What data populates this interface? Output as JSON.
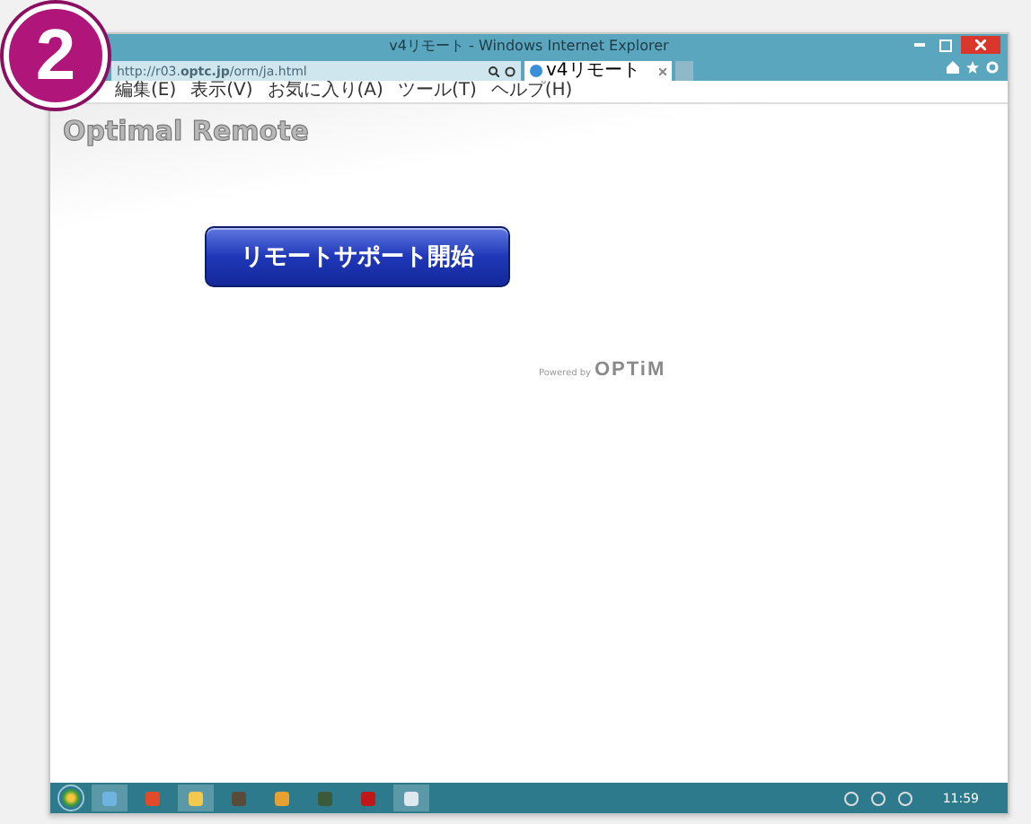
{
  "badge": "2",
  "window": {
    "title": "v4リモート - Windows Internet Explorer"
  },
  "address_bar": {
    "value": "http://r03.**optc.jp**/orm/ja.html"
  },
  "tabs": [
    {
      "label": "v4リモート",
      "selected": true
    }
  ],
  "menu": [
    "編集(E)",
    "表示(V)",
    "お気に入り(A)",
    "ツール(T)",
    "ヘルプ(H)"
  ],
  "page": {
    "logo": "Optimal Remote",
    "start_button": "リモートサポート開始",
    "powered_by": "Powered by",
    "brand": "OPTiM"
  },
  "taskbar": {
    "clock": "11:59"
  }
}
